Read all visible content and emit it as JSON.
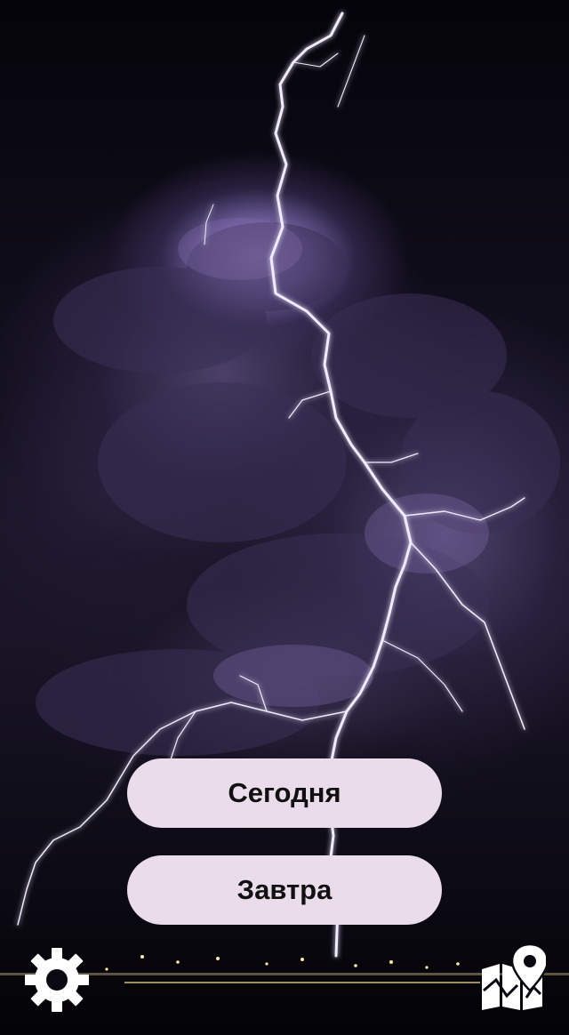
{
  "background": {
    "description_icon": "night-lightning-storm-wallpaper",
    "accent_color": "#b8a6ff"
  },
  "buttons": {
    "today_label": "Сегодня",
    "tomorrow_label": "Завтра",
    "background_color": "#ebdcec"
  },
  "toolbar": {
    "settings_icon": "gear-icon",
    "map_icon": "map-location-icon"
  }
}
